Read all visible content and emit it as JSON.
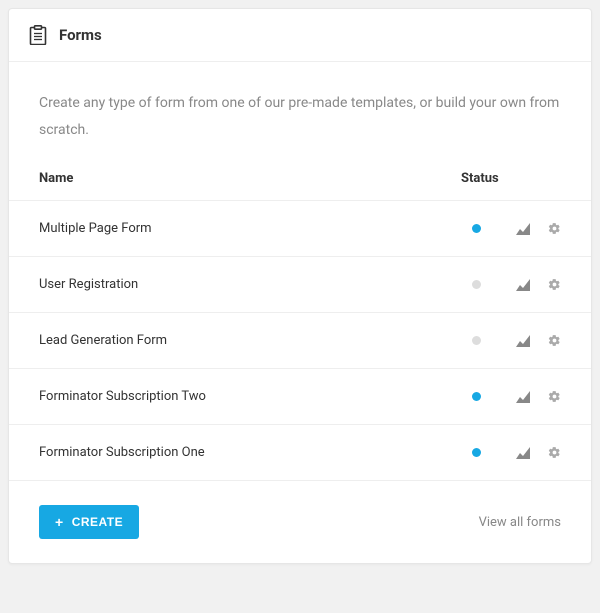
{
  "header": {
    "title": "Forms"
  },
  "intro": "Create any type of form from one of our pre-made templates, or build your own from scratch.",
  "columns": {
    "name": "Name",
    "status": "Status"
  },
  "rows": [
    {
      "name": "Multiple Page Form",
      "active": true
    },
    {
      "name": "User Registration",
      "active": false
    },
    {
      "name": "Lead Generation Form",
      "active": false
    },
    {
      "name": "Forminator Subscription Two",
      "active": true
    },
    {
      "name": "Forminator Subscription One",
      "active": true
    }
  ],
  "footer": {
    "create_label": "CREATE",
    "view_all_label": "View all forms"
  },
  "icons": {
    "clipboard": "clipboard-icon",
    "stats": "stats-icon",
    "gear": "gear-icon",
    "plus": "plus-icon"
  }
}
